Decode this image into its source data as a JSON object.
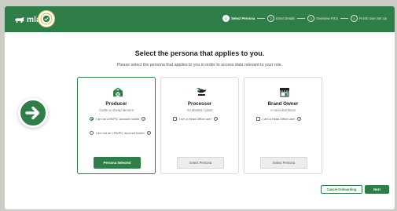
{
  "header": {
    "brand": "mla",
    "steps": [
      {
        "num": "1",
        "label": "Select Persona",
        "active": true
      },
      {
        "num": "2",
        "label": "Enter Details",
        "active": false
      },
      {
        "num": "3",
        "label": "Overview PICs",
        "active": false
      },
      {
        "num": "4",
        "label": "Finish User Set Up",
        "active": false
      }
    ],
    "colors": {
      "brand_green": "#2f7d48"
    }
  },
  "main": {
    "title": "Select the persona that applies to you.",
    "subtitle": "Please select the persona that applies to you in order to access data relevant to your role."
  },
  "cards": [
    {
      "name": "Producer",
      "desc": "Cattle or sheep farmers",
      "icon": "barn-icon",
      "selected": true,
      "options": [
        {
          "label": "I am an LPA/PIC account holder",
          "type": "radio",
          "checked": true
        },
        {
          "label": "I am not an LPA/PIC account holder",
          "type": "radio",
          "checked": false
        }
      ],
      "button": "Persona Selected"
    },
    {
      "name": "Processor",
      "desc": "An abattoir / plant",
      "icon": "processor-icon",
      "selected": false,
      "options": [
        {
          "label": "I am a Head Office user",
          "type": "checkbox",
          "checked": false
        }
      ],
      "button": "Select Persona"
    },
    {
      "name": "Brand Owner",
      "desc": "A meat distributor",
      "icon": "storefront-icon",
      "selected": false,
      "options": [
        {
          "label": "I am a Head Office user",
          "type": "checkbox",
          "checked": false
        }
      ],
      "button": "Select Persona"
    }
  ],
  "footer": {
    "cancel_label": "Cancel Onboarding",
    "next_label": "Next"
  },
  "overlay": {
    "icon": "arrow-right-icon"
  }
}
